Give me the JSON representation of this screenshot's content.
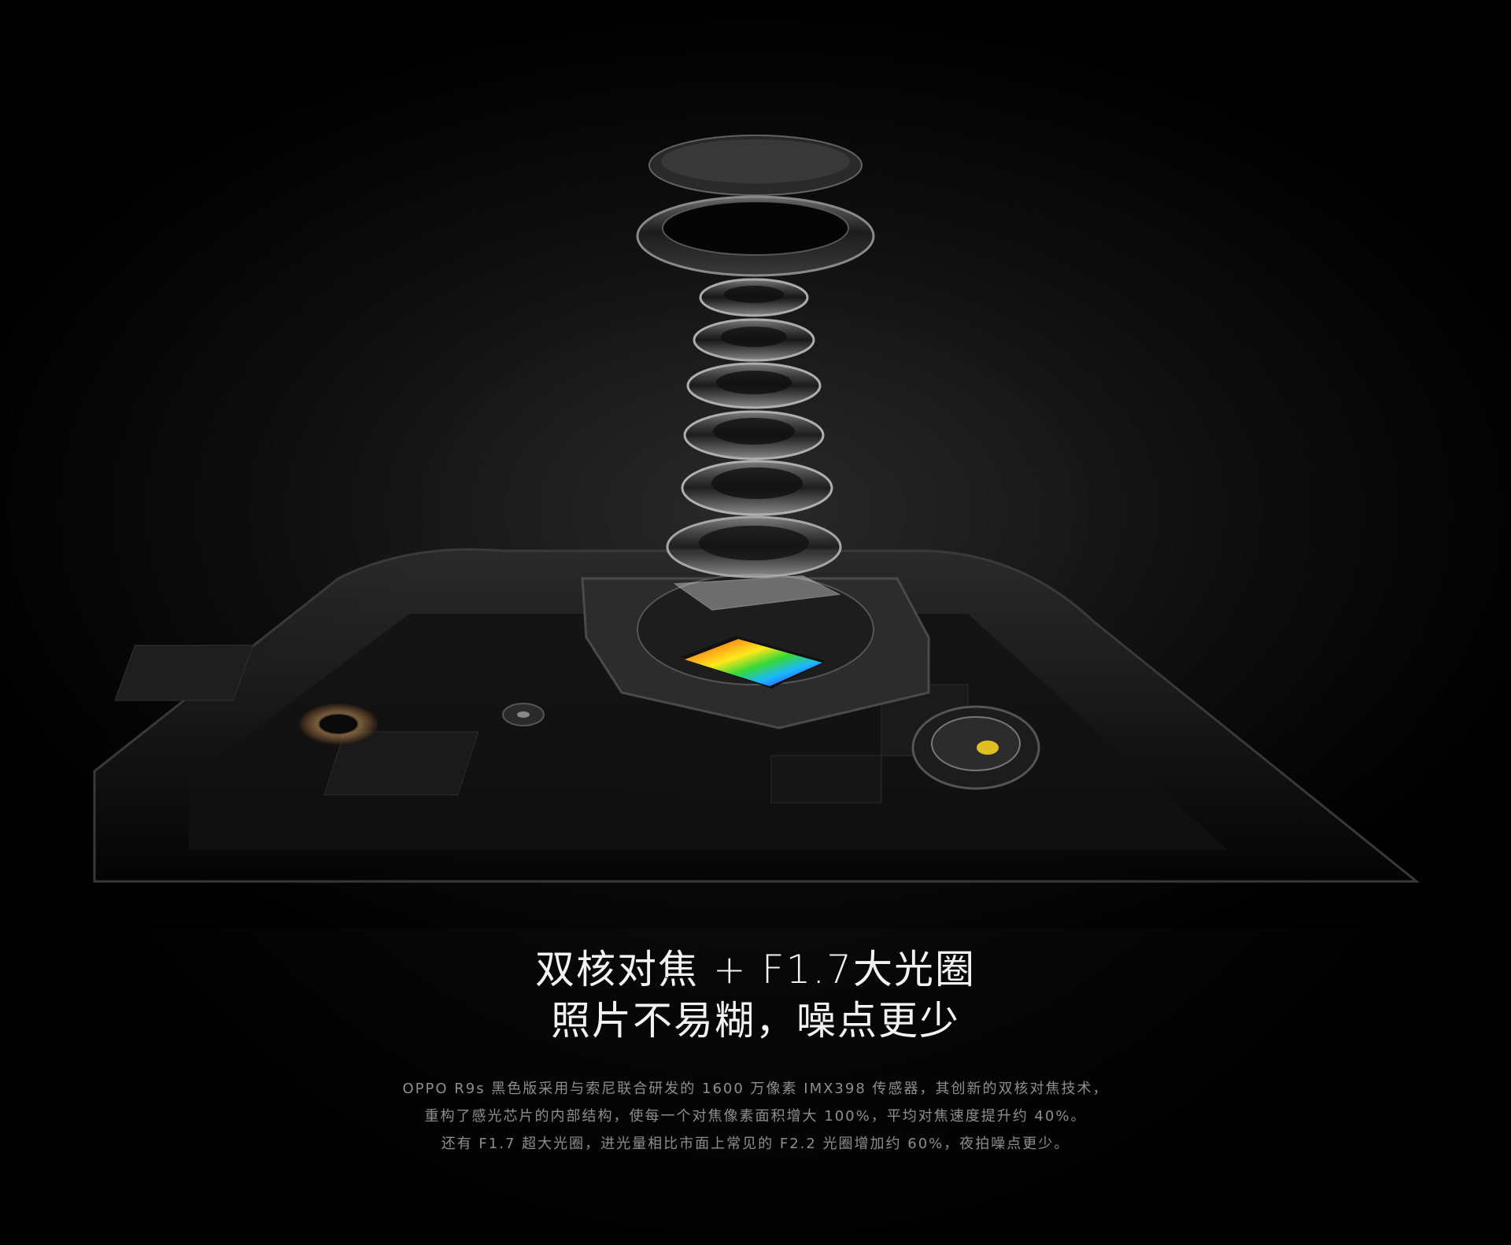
{
  "headline": {
    "line1": "双核对焦 + F1.7大光圈",
    "line2": "照片不易糊，噪点更少"
  },
  "description": {
    "line1": "OPPO R9s 黑色版采用与索尼联合研发的 1600 万像素 IMX398 传感器，其创新的双核对焦技术，",
    "line2": "重构了感光芯片的内部结构，使每一个对焦像素面积增大 100%，平均对焦速度提升约 40%。",
    "line3": "还有 F1.7 超大光圈，进光量相比市面上常见的 F2.2 光圈增加约 60%，夜拍噪点更少。"
  }
}
